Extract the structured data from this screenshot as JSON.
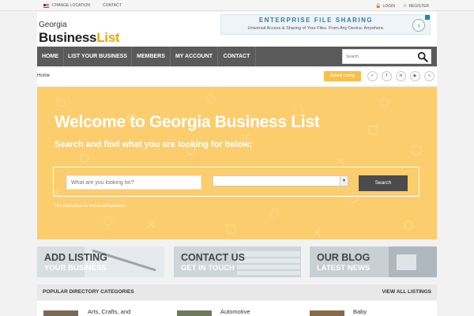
{
  "topbar": {
    "change_location": "CHANGE LOCATION",
    "contact": "CONTACT",
    "login": "LOGIN",
    "register": "REGISTER"
  },
  "logo": {
    "state": "Georgia",
    "business": "Business",
    "list": "List"
  },
  "ad": {
    "headline": "ENTERPRISE FILE SHARING",
    "subline": "Universal Access & Sharing of Your Files. From Any Device, Anywhere."
  },
  "nav": {
    "items": [
      "HOME",
      "LIST YOUR BUSINESS",
      "MEMBERS",
      "MY ACCOUNT",
      "CONTACT"
    ],
    "search_placeholder": "Search"
  },
  "breadcrumb": {
    "home": "Home"
  },
  "submit_button": "Submit Listing",
  "social": [
    "twitter-icon",
    "facebook-icon",
    "linkedin-icon",
    "youtube-icon",
    "rss-icon"
  ],
  "hero": {
    "title": "Welcome to Georgia Business List",
    "subtitle": "Search and find what you are looking for below;",
    "query_placeholder": "What are you looking for?",
    "select_value": "",
    "search_button": "Search",
    "tagline": "The best place to find local business!"
  },
  "tiles": [
    {
      "top": "ADD LISTING",
      "bottom": "YOUR BUSINESS"
    },
    {
      "top": "CONTACT US",
      "bottom": "GET IN TOUCH"
    },
    {
      "top": "OUR BLOG",
      "bottom": "LATEST NEWS"
    }
  ],
  "categories": {
    "title": "POPULAR DIRECTORY CATEGORIES",
    "view_all": "VIEW ALL LISTINGS",
    "items": [
      "Arts, Crafts, and",
      "Automotive",
      "Baby"
    ]
  },
  "colors": {
    "accent": "#f8c04a",
    "hero": "#fccd6d",
    "nav": "#5a5a5a",
    "logo_accent": "#f0a500"
  }
}
